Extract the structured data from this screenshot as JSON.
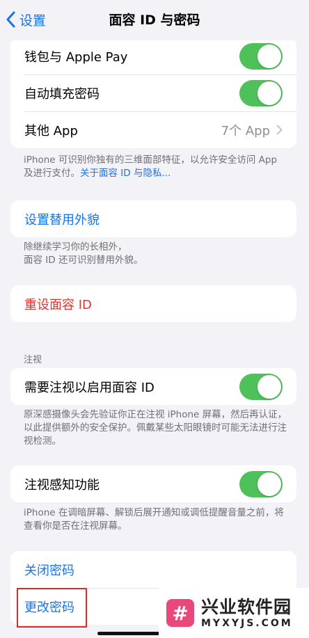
{
  "nav": {
    "back_label": "设置",
    "title": "面容 ID 与密码"
  },
  "apps_section": {
    "rows": [
      {
        "label": "钱包与 Apple Pay",
        "toggle": "on"
      },
      {
        "label": "自动填充密码",
        "toggle": "on"
      },
      {
        "label": "其他 App",
        "value": "7个 App"
      }
    ],
    "footer_text": "iPhone 可识别你独有的三维面部特征，以允许安全访问 App 及进行支付。",
    "footer_link": "关于面容 ID 与隐私..."
  },
  "alternate_appearance": {
    "label": "设置替用外貌",
    "footer_line1": "除继续学习你的长相外，",
    "footer_line2": "面容 ID 还可识别替用外貌。"
  },
  "reset": {
    "label": "重设面容 ID"
  },
  "attention": {
    "header": "注视",
    "require_label": "需要注视以启用面容 ID",
    "require_toggle": "on",
    "require_footer": "原深感摄像头会先验证你正在注视 iPhone 屏幕，然后再认证，以此提供额外的安全保护。佩戴某些太阳眼镜时可能无法进行注视检测。",
    "aware_label": "注视感知功能",
    "aware_toggle": "on",
    "aware_footer": "iPhone 在调暗屏幕、解锁后展开通知或调低提醒音量之前，将查看你是否在注视屏幕。"
  },
  "passcode": {
    "turn_off_label": "关闭密码",
    "change_label": "更改密码"
  },
  "watermark": {
    "logo_glyph": "#",
    "name": "兴业软件园",
    "url": "MYXYJS.COM"
  },
  "colors": {
    "accent": "#1a73e8",
    "toggle_on": "#4ec15a",
    "destructive": "#e5312b",
    "highlight": "#d62b2b"
  }
}
